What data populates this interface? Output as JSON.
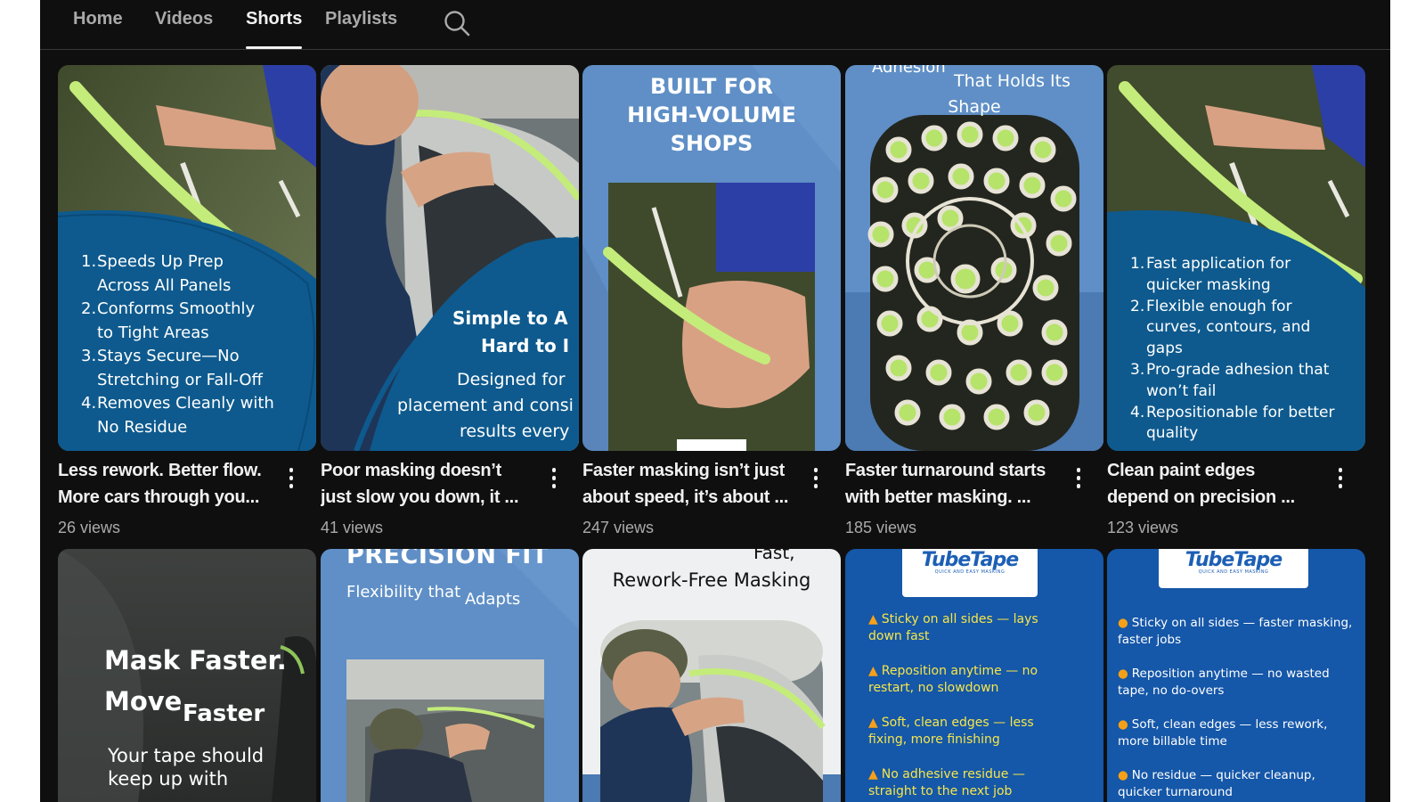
{
  "tabs": [
    {
      "label": "Home",
      "active": false
    },
    {
      "label": "Videos",
      "active": false
    },
    {
      "label": "Shorts",
      "active": true
    },
    {
      "label": "Playlists",
      "active": false
    }
  ],
  "search_icon": "search-icon",
  "colors": {
    "background": "#0f0f0f",
    "text_primary": "#f1f1f1",
    "text_secondary": "#aaaaaa",
    "brand_blue": "#0e5a8e",
    "overlay_blue": "#5f8fc6",
    "tape_green": "#b6e36a",
    "bullet_yellow": "#f6e64a"
  },
  "shorts": [
    {
      "title_line1": "Less rework. Better flow.",
      "title_line2": "More cars through you...",
      "views": "26 views",
      "overlay": {
        "items": [
          {
            "num": "1.",
            "lines": [
              "Speeds Up Prep",
              "Across All Panels"
            ]
          },
          {
            "num": "2.",
            "lines": [
              "Conforms Smoothly",
              "to Tight Areas"
            ]
          },
          {
            "num": "3.",
            "lines": [
              "Stays Secure—No",
              "Stretching or Fall-Off"
            ]
          },
          {
            "num": "4.",
            "lines": [
              "Removes Cleanly with",
              "No Residue"
            ]
          }
        ]
      }
    },
    {
      "title_line1": "Poor masking doesn’t",
      "title_line2": "just slow you down, it ...",
      "views": "41 views",
      "overlay": {
        "headline1": "Simple to A",
        "headline2": "Hard to I",
        "body1": "Designed for",
        "body2": "placement and consi",
        "body3": "results every"
      }
    },
    {
      "title_line1": "Faster masking isn’t just",
      "title_line2": "about speed, it’s about ...",
      "views": "247 views",
      "overlay": {
        "headline": [
          "BUILT FOR",
          "HIGH-VOLUME",
          "SHOPS"
        ]
      }
    },
    {
      "title_line1": "Faster turnaround starts",
      "title_line2": "with better masking. ...",
      "views": "185 views",
      "overlay": {
        "top_cut": "Adhesion",
        "line1": "That Holds Its",
        "line2": "Shape"
      }
    },
    {
      "title_line1": "Clean paint edges",
      "title_line2": "depend on precision ...",
      "views": "123 views",
      "overlay": {
        "items": [
          {
            "num": "1.",
            "lines": [
              "Fast application for",
              "quicker masking"
            ]
          },
          {
            "num": "2.",
            "lines": [
              "Flexible enough for",
              "curves, contours, and",
              "gaps"
            ]
          },
          {
            "num": "3.",
            "lines": [
              "Pro-grade adhesion that",
              "won’t fail"
            ]
          },
          {
            "num": "4.",
            "lines": [
              "Repositionable for better",
              "quality"
            ]
          }
        ]
      }
    }
  ],
  "second_row": [
    {
      "headline1": "Mask Faster.",
      "headline2a": "Move",
      "headline2b": "Faster",
      "sub1": "Your tape should",
      "sub2": "keep up with"
    },
    {
      "headline": "PRECISION FIT",
      "sub_a": "Flexibility that",
      "sub_b": "Adapts"
    },
    {
      "top_cut": "Fast,",
      "headline": "Rework-Free Masking"
    },
    {
      "logo_brand": "TubeTape",
      "logo_tag": "QUICK AND EASY MASKING",
      "bullets": [
        {
          "line1": "Sticky on all sides — lays",
          "line2": "down fast"
        },
        {
          "line1": "Reposition anytime — no",
          "line2": "restart, no slowdown"
        },
        {
          "line1": "Soft, clean edges — less",
          "line2": "fixing, more finishing"
        },
        {
          "line1": "No adhesive residue —",
          "line2": "straight to the next job"
        }
      ]
    },
    {
      "logo_brand": "TubeTape",
      "logo_tag": "QUICK AND EASY MASKING",
      "bullets": [
        {
          "line1": "Sticky on all sides — faster masking,",
          "line2": "faster jobs"
        },
        {
          "line1": "Reposition anytime — no wasted",
          "line2": "tape, no do-overs"
        },
        {
          "line1": "Soft, clean edges — less rework,",
          "line2": "more billable time"
        },
        {
          "line1": "No residue — quicker cleanup,",
          "line2": "quicker turnaround"
        }
      ]
    }
  ]
}
